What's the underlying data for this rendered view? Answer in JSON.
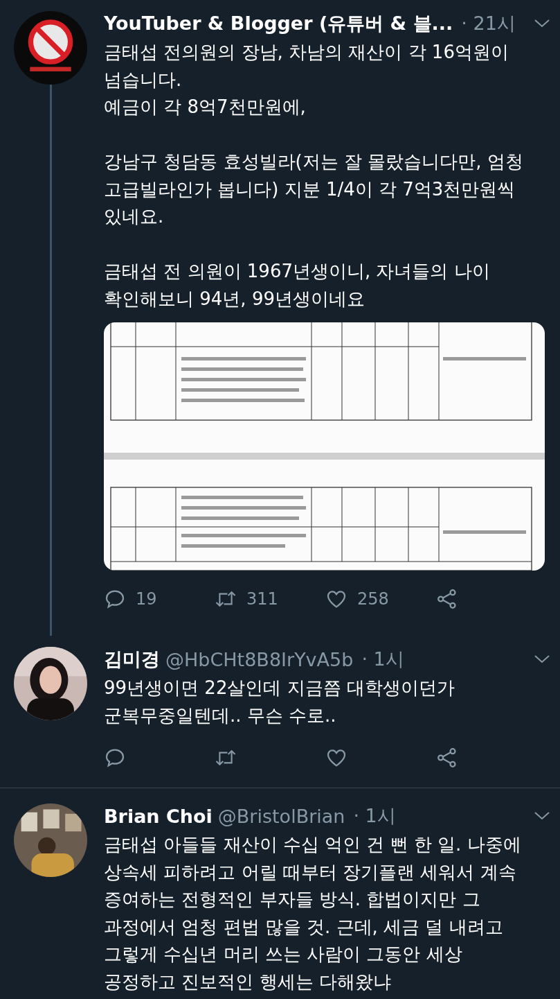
{
  "tweets": [
    {
      "name": "YouTuber & Blogger (유튜버 & 블...",
      "time": "· 21시",
      "thread_line": true,
      "text": "금태섭 전의원의 장남, 차남의 재산이 각 16억원이\n넘습니다.\n예금이 각 8억7천만원에,\n\n강남구 청담동 효성빌라(저는 잘 몰랐습니다만, 엄청\n고급빌라인가 봅니다) 지분 1/4이 각 7억3천만원씩\n있네요.\n\n금태섭 전 의원이 1967년생이니, 자녀들의 나이\n확인해보니 94년, 99년생이네요",
      "replies": "19",
      "retweets": "311",
      "likes": "258"
    },
    {
      "name": "김미경",
      "handle": "@HbCHt8B8IrYvA5b",
      "time": "· 1시",
      "thread_line": false,
      "text": "99년생이면 22살인데 지금쯤 대학생이던가\n군복무중일텐데.. 무슨 수로.."
    },
    {
      "name": "Brian Choi",
      "handle": "@BristolBrian",
      "time": "· 1시",
      "thread_line": false,
      "text": "금태섭 아들들 재산이 수십 억인 건 뻔 한 일. 나중에\n상속세 피하려고 어릴 때부터 장기플랜 세워서 계속\n증여하는 전형적인 부자들 방식. 합법이지만 그\n과정에서 엄청 편법 많을 것. 근데, 세금 덜 내려고\n그렇게 수십년 머리 쓰는 사람이 그동안 세상\n공정하고 진보적인 행세는 다해왔냐"
    }
  ]
}
